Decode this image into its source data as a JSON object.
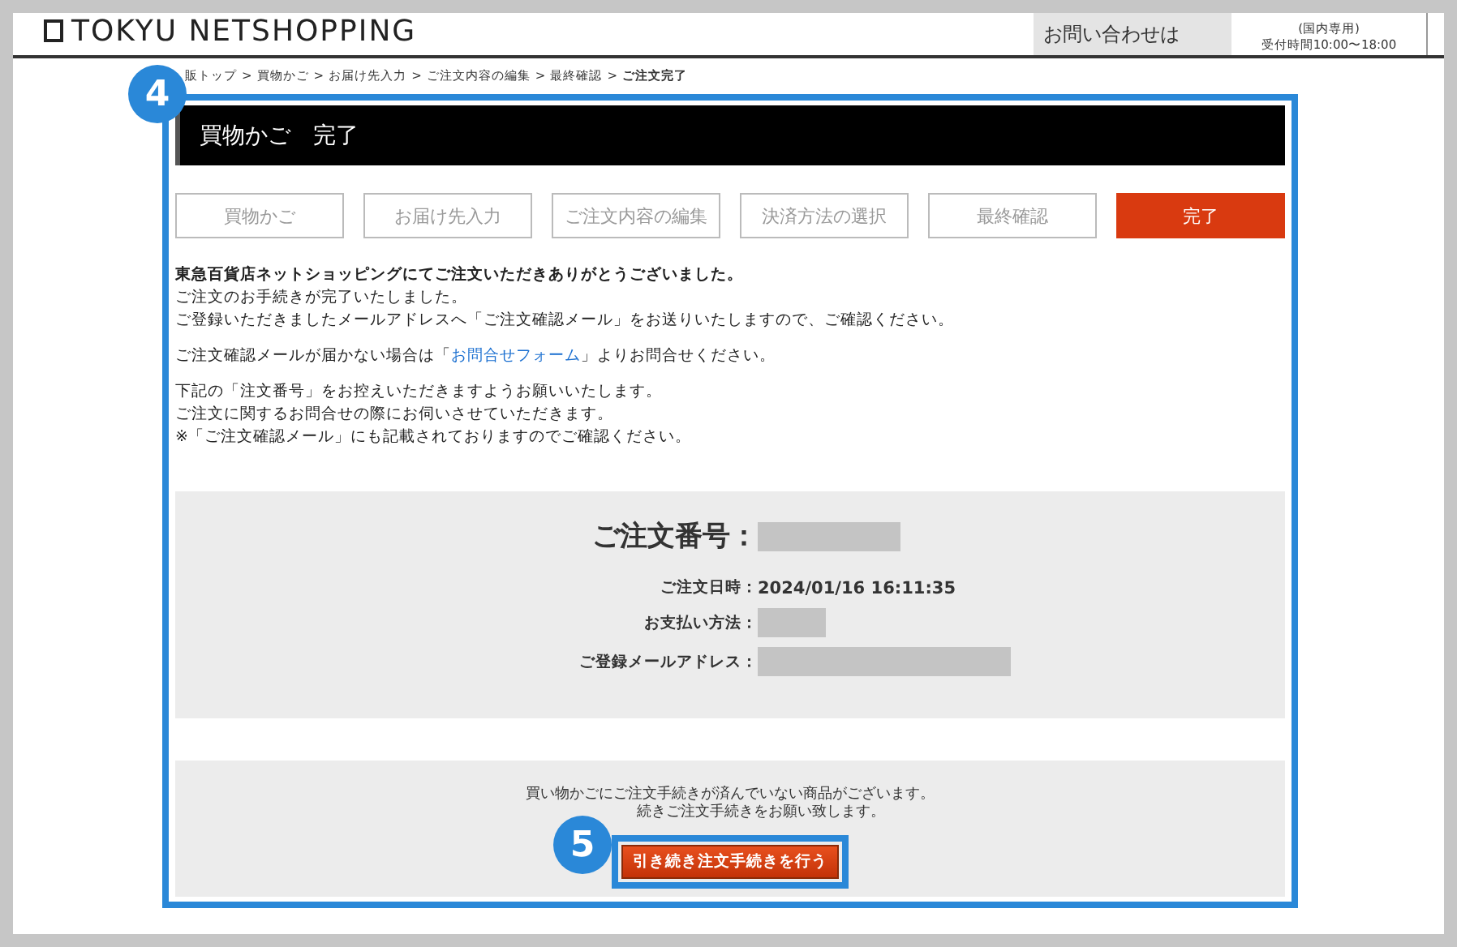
{
  "header": {
    "logo": "TOKYU NETSHOPPING",
    "contact_label": "お問い合わせは",
    "contact_note": "(国内専用)",
    "contact_hours": "受付時間10:00〜18:00"
  },
  "breadcrumb_separator": ">",
  "breadcrumb": [
    {
      "label": "販トップ",
      "current": false
    },
    {
      "label": "買物かご",
      "current": false
    },
    {
      "label": "お届け先入力",
      "current": false
    },
    {
      "label": "ご注文内容の編集",
      "current": false
    },
    {
      "label": "最終確認",
      "current": false
    },
    {
      "label": "ご注文完了",
      "current": true
    }
  ],
  "callouts": [
    {
      "number": "4"
    },
    {
      "number": "5"
    }
  ],
  "page_title": "買物かご　完了",
  "steps": [
    {
      "label": "買物かご",
      "selected": false
    },
    {
      "label": "お届け先入力",
      "selected": false
    },
    {
      "label": "ご注文内容の編集",
      "selected": false
    },
    {
      "label": "決済方法の選択",
      "selected": false
    },
    {
      "label": "最終確認",
      "selected": false
    },
    {
      "label": "完了",
      "selected": true
    }
  ],
  "message": {
    "heading": "東急百貨店ネットショッピングにてご注文いただきありがとうございました。",
    "lines": [
      "ご注文のお手続きが完了いたしました。",
      "ご登録いただきましたメールアドレスへ「ご注文確認メール」をお送りいたしますので、ご確認ください。"
    ],
    "contact_before": "ご注文確認メールが届かない場合は「",
    "contact_link": "お問合せフォーム",
    "contact_after": "」よりお問合せください。",
    "notes": [
      "下記の「注文番号」をお控えいただきますようお願いいたします。",
      "ご注文に関するお問合せの際にお伺いさせていただきます。",
      "※「ご注文確認メール」にも記載されておりますのでご確認ください。"
    ]
  },
  "order": {
    "number_label": "ご注文番号：",
    "details": [
      {
        "label": "ご注文日時：",
        "value": "2024/01/16 16:11:35",
        "redacted": false
      },
      {
        "label": "お支払い方法：",
        "redacted": true
      },
      {
        "label": "ご登録メールアドレス：",
        "redacted": true
      }
    ]
  },
  "pending": {
    "lines": [
      "買い物かごにご注文手続きが済んでいない商品がございます。",
      "続きご注文手続きをお願い致します。"
    ],
    "button": "引き続き注文手続きを行う"
  }
}
